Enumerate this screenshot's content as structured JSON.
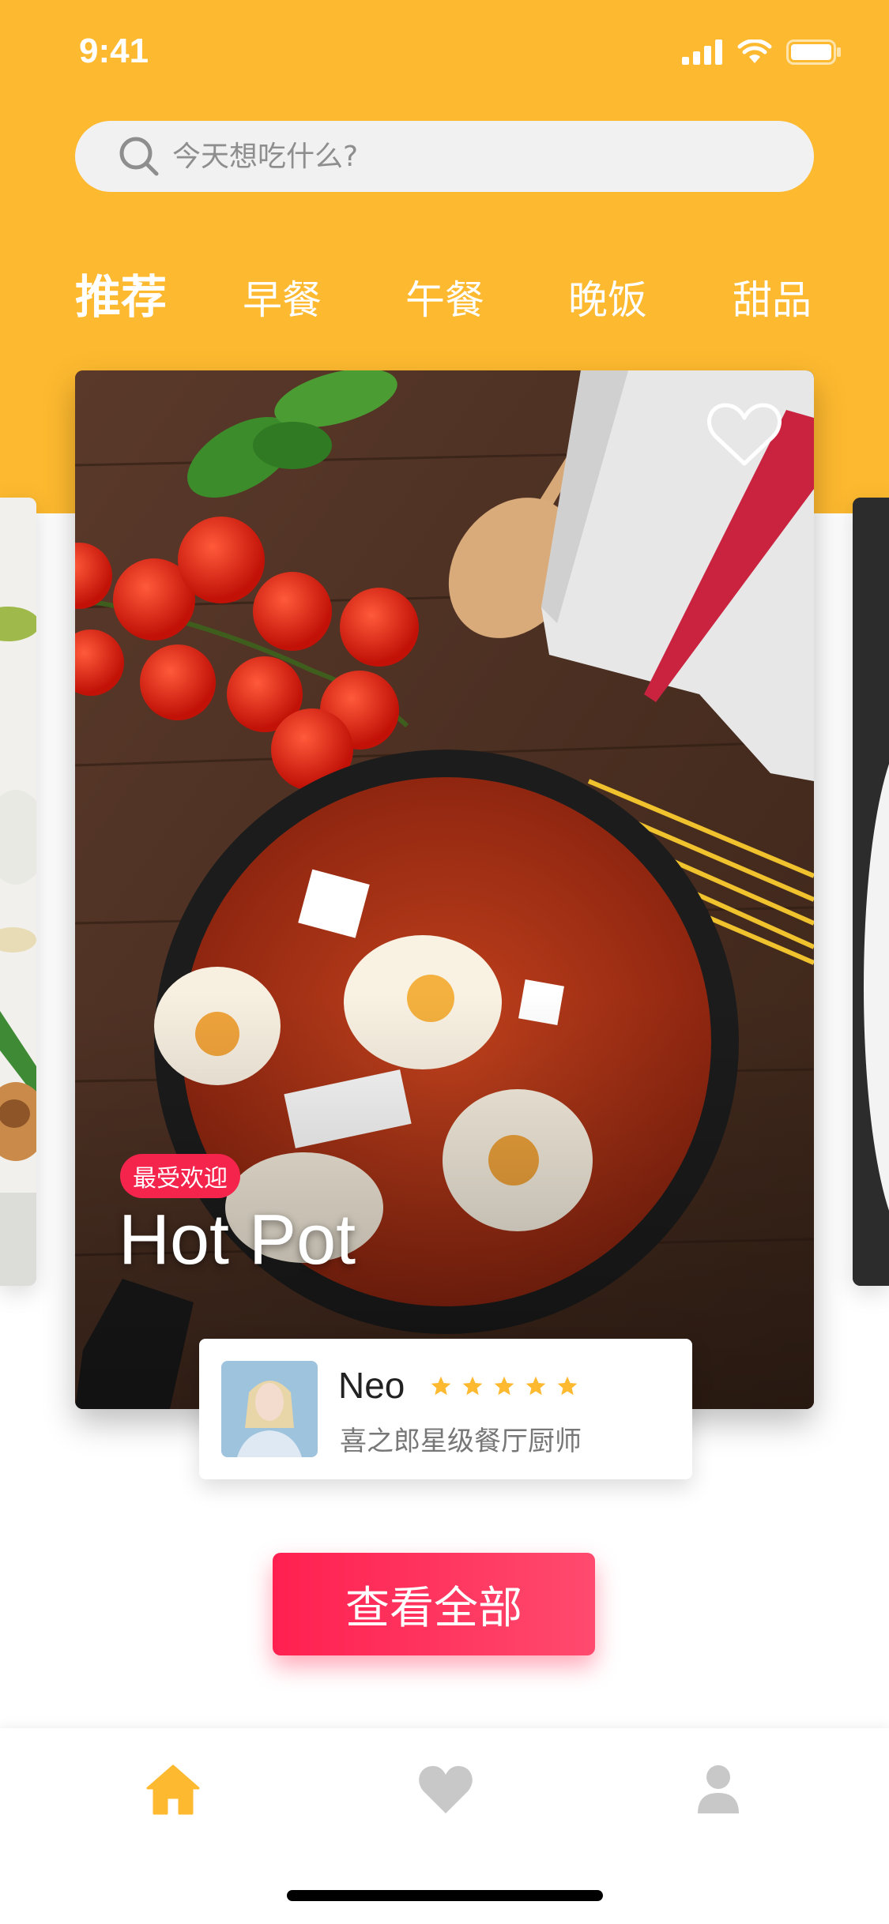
{
  "status_bar": {
    "time": "9:41"
  },
  "search": {
    "placeholder": "今天想吃什么?"
  },
  "tabs": [
    {
      "label": "推荐",
      "active": true
    },
    {
      "label": "早餐",
      "active": false
    },
    {
      "label": "午餐",
      "active": false
    },
    {
      "label": "晚饭",
      "active": false
    },
    {
      "label": "甜品",
      "active": false
    }
  ],
  "featured": {
    "badge": "最受欢迎",
    "title": "Hot Pot",
    "favorite_icon": "heart-outline-icon"
  },
  "chef": {
    "name": "Neo",
    "rating": 5,
    "rating_max": 5,
    "title": "喜之郎星级餐厅厨师"
  },
  "actions": {
    "view_all": "查看全部"
  },
  "bottom_nav": [
    {
      "icon": "home-icon",
      "active": true
    },
    {
      "icon": "heart-icon",
      "active": false
    },
    {
      "icon": "user-icon",
      "active": false
    }
  ],
  "colors": {
    "brand_yellow": "#FDB92F",
    "accent_red": "#F4244C",
    "star_yellow": "#FDB92F",
    "inactive_gray": "#C8C8C8"
  }
}
